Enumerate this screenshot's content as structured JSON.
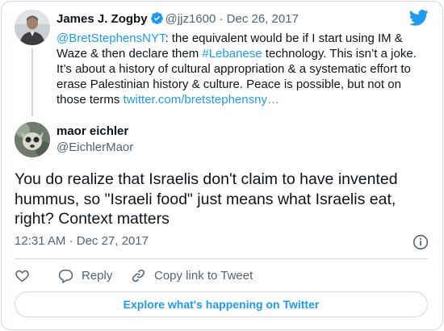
{
  "parent_tweet": {
    "name": "James J. Zogby",
    "handle": "@jjz1600",
    "separator": "·",
    "date": "Dec 26, 2017",
    "text_parts": [
      {
        "text": "@BretStephensNYT",
        "link": true
      },
      {
        "text": ": the equivalent would be if I start using IM & Waze & then declare them ",
        "link": false
      },
      {
        "text": "#Lebanese",
        "link": true
      },
      {
        "text": " technology. This isn’t a joke. It’s about a history of cultural appropriation & a systematic effort to erase Palestinian history & culture. Peace is possible, but not on those terms ",
        "link": false
      },
      {
        "text": "twitter.com/bretstephensny…",
        "link": true
      }
    ]
  },
  "main_tweet": {
    "name": "maor eichler",
    "handle": "@EichlerMaor",
    "text": "You do realize that Israelis don't claim to have invented hummus, so \"Israeli food\" just means what Israelis eat, right? Context matters",
    "time": "12:31 AM",
    "separator": "·",
    "date": "Dec 27, 2017"
  },
  "actions": {
    "like_icon": "heart-icon",
    "reply_label": "Reply",
    "copy_label": "Copy link to Tweet"
  },
  "explore_label": "Explore what's happening on Twitter",
  "colors": {
    "accent": "#1d9bf0",
    "muted": "#536471",
    "border": "#cfd9de"
  }
}
